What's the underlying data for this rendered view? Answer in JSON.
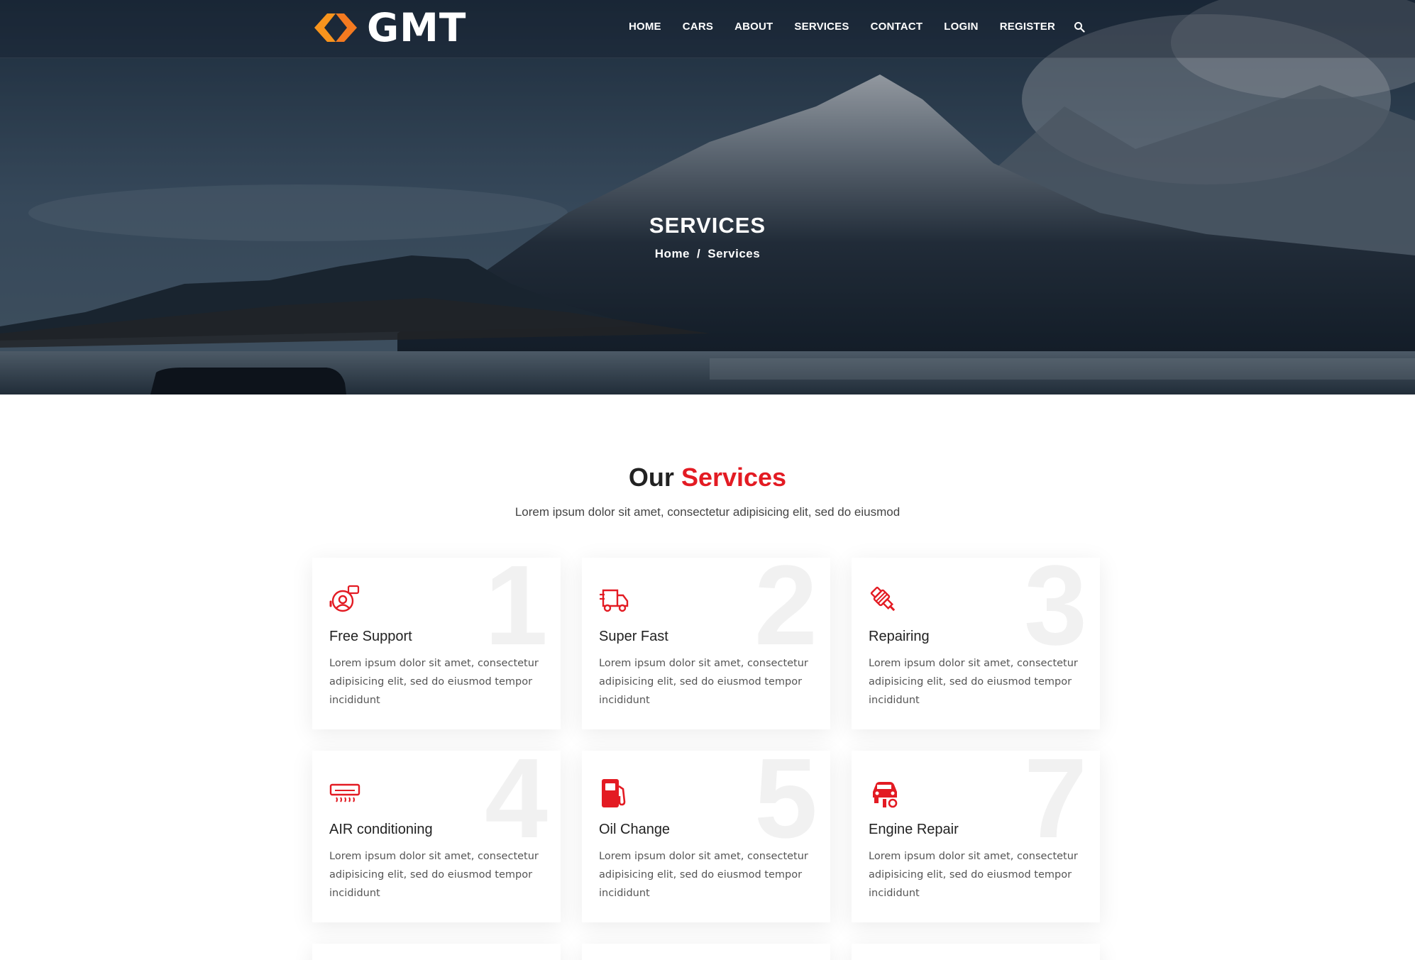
{
  "brand": {
    "name": "GMT",
    "accent": "#f7941d",
    "primary_red": "#e31b23"
  },
  "nav": {
    "items": [
      "HOME",
      "CARS",
      "ABOUT",
      "SERVICES",
      "CONTACT",
      "LOGIN",
      "REGISTER"
    ],
    "search_icon": "search-icon"
  },
  "hero": {
    "title": "SERVICES",
    "breadcrumb": {
      "home": "Home",
      "separator": "/",
      "current": "Services"
    }
  },
  "section": {
    "title_part1": "Our",
    "title_part2": "Services",
    "subtitle": "Lorem ipsum dolor sit amet, consectetur adipisicing elit, sed do eiusmod"
  },
  "services": [
    {
      "number": "1",
      "title": "Free Support",
      "icon": "support-icon",
      "text": "Lorem ipsum dolor sit amet, consectetur adipisicing elit, sed do eiusmod tempor incididunt"
    },
    {
      "number": "2",
      "title": "Super Fast",
      "icon": "fast-truck-icon",
      "text": "Lorem ipsum dolor sit amet, consectetur adipisicing elit, sed do eiusmod tempor incididunt"
    },
    {
      "number": "3",
      "title": "Repairing",
      "icon": "spark-plug-icon",
      "text": "Lorem ipsum dolor sit amet, consectetur adipisicing elit, sed do eiusmod tempor incididunt"
    },
    {
      "number": "4",
      "title": "AIR conditioning",
      "icon": "air-conditioner-icon",
      "text": "Lorem ipsum dolor sit amet, consectetur adipisicing elit, sed do eiusmod tempor incididunt"
    },
    {
      "number": "5",
      "title": "Oil Change",
      "icon": "fuel-pump-icon",
      "text": "Lorem ipsum dolor sit amet, consectetur adipisicing elit, sed do eiusmod tempor incididunt"
    },
    {
      "number": "7",
      "title": "Engine Repair",
      "icon": "car-repair-icon",
      "text": "Lorem ipsum dolor sit amet, consectetur adipisicing elit, sed do eiusmod tempor incididunt"
    }
  ]
}
